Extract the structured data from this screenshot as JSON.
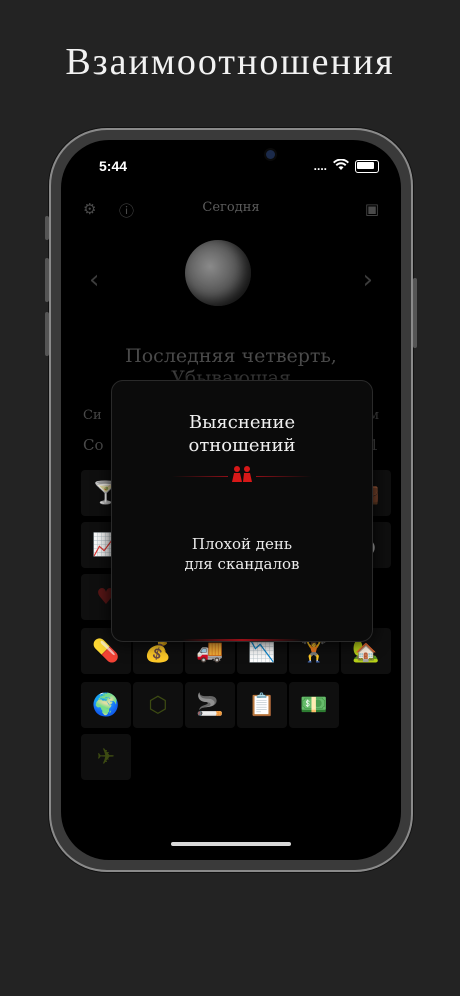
{
  "banner": {
    "title": "Взаимоотношения"
  },
  "status": {
    "time": "5:44",
    "signal": "....",
    "wifi": "wifi-icon",
    "battery": "battery-icon"
  },
  "topbar": {
    "title": "Сегодня",
    "left_icons": [
      "gear-icon",
      "info-icon"
    ],
    "right_icon": "calendar-icon"
  },
  "moon": {
    "phase_line1": "Последняя четверть,",
    "phase_line2": "Убывающая"
  },
  "info_rows": {
    "row1_left": "Си",
    "row1_right": "км",
    "row2_left": "Со",
    "row2_right": "21"
  },
  "modal": {
    "title_line1": "Выяснение",
    "title_line2": "отношений",
    "icon": "couple-icon",
    "desc_line1": "Плохой день",
    "desc_line2": "для скандалов"
  },
  "grid_icons": [
    "🍸",
    "💼",
    "📈",
    "♥",
    "💍",
    "💊",
    "💰",
    "🚚",
    "📉",
    "🏋",
    "🏡",
    "🌍",
    "⬡",
    "🚬",
    "📋",
    "💵",
    "✈"
  ],
  "colors": {
    "accent_red": "#d81818",
    "icon_green": "#8bb31d",
    "background": "#000000"
  }
}
